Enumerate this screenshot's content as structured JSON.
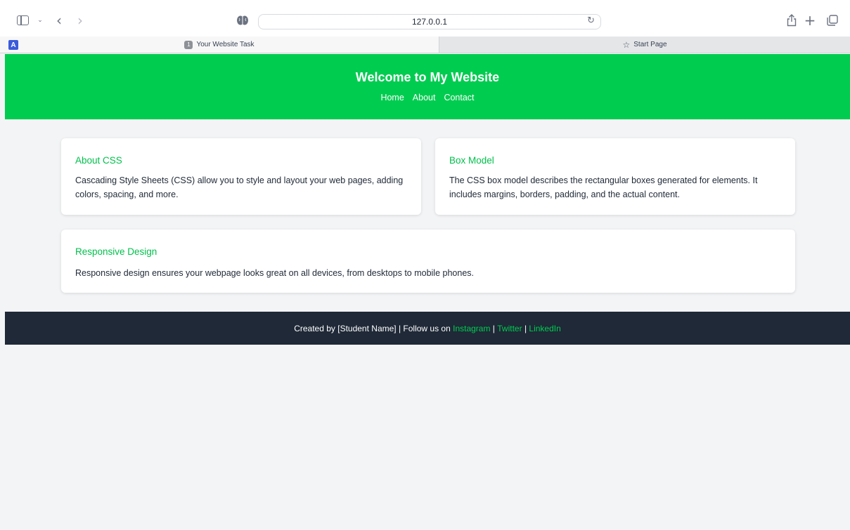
{
  "browser": {
    "url": "127.0.0.1",
    "tabs": [
      {
        "number": "1",
        "title": "Your Website Task"
      },
      {
        "title": "Start Page"
      }
    ],
    "extension_badge": "A",
    "icons": [
      "sidebar-icon",
      "chevron-down-icon",
      "back-icon",
      "forward-icon",
      "brain-icon",
      "reload-icon",
      "share-icon",
      "plus-icon",
      "tab-overview-icon",
      "star-icon"
    ]
  },
  "site": {
    "title": "Welcome to My Website",
    "nav": [
      "Home",
      "About",
      "Contact"
    ]
  },
  "cards": [
    {
      "title": "About CSS",
      "text": "Cascading Style Sheets (CSS) allow you to style and layout your web pages, adding colors, spacing, and more."
    },
    {
      "title": "Box Model",
      "text": "The CSS box model describes the rectangular boxes generated for elements. It includes margins, borders, padding, and the actual content."
    },
    {
      "title": "Responsive Design",
      "text": "Responsive design ensures your webpage looks great on all devices, from desktops to mobile phones."
    }
  ],
  "footer": {
    "prefix": "Created by [Student Name] | Follow us on ",
    "links": [
      "Instagram",
      "Twitter",
      "LinkedIn"
    ],
    "separator": " | "
  },
  "colors": {
    "accent": "#00cc50",
    "footer_bg": "#1f2937",
    "page_bg": "#f3f4f6"
  }
}
